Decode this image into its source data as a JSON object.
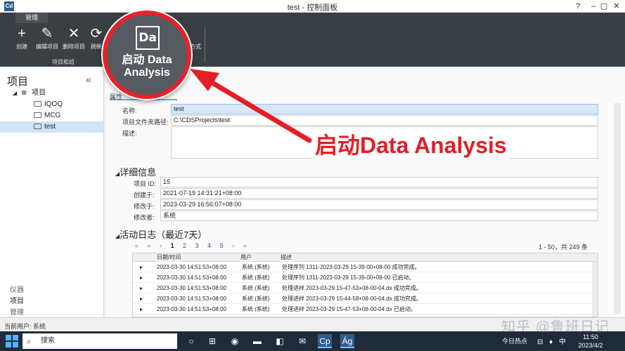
{
  "window": {
    "app_icon": "Cd",
    "title": "test - 控制面板",
    "controls": [
      "?",
      "–",
      "▢",
      "✕"
    ]
  },
  "ribbon": {
    "tab": "管理",
    "buttons": [
      {
        "label": "创建",
        "icon": "plus-icon",
        "glyph": "+"
      },
      {
        "label": "编辑项目",
        "icon": "pencil-icon",
        "glyph": "✎"
      },
      {
        "label": "删除项目",
        "icon": "close-icon",
        "glyph": "✕"
      },
      {
        "label": "刷新",
        "icon": "refresh-icon",
        "glyph": "⟳"
      }
    ],
    "group_label": "项目和组",
    "partial_label": "式方式",
    "launch": {
      "icon_text": "Da",
      "label": "启动 Data Analysis"
    }
  },
  "left_panel": {
    "title": "项目",
    "collapse_glyph": "«",
    "tree": [
      {
        "label": "项目",
        "level": 0
      },
      {
        "label": "IQOQ",
        "level": 1
      },
      {
        "label": "MCG",
        "level": 1
      },
      {
        "label": "test",
        "level": 1,
        "selected": true
      }
    ],
    "footer": [
      {
        "label": "仪器"
      },
      {
        "label": "项目",
        "active": true
      },
      {
        "label": "管理"
      }
    ]
  },
  "properties": {
    "tab_label": "属性",
    "fields": [
      {
        "label": "名称:",
        "value": "test"
      },
      {
        "label": "项目文件夹路径:",
        "value": "C:\\CDSProjects\\test"
      },
      {
        "label": "描述:",
        "value": ""
      }
    ]
  },
  "details": {
    "title": "详细信息",
    "fields": [
      {
        "label": "项目 ID:",
        "value": "15"
      },
      {
        "label": "创建于:",
        "value": "2021-07-19 14:31:21+08:00"
      },
      {
        "label": "修改于:",
        "value": "2023-03-29 16:56:07+08:00"
      },
      {
        "label": "修改者:",
        "value": "系统"
      }
    ]
  },
  "activity": {
    "title": "活动日志（最近7天）",
    "pager": {
      "first": "«",
      "prev_group": "«",
      "prev": "‹",
      "pages": [
        "1",
        "2",
        "3",
        "4",
        "5"
      ],
      "current_page": "1",
      "next": "›",
      "next_group": "»",
      "last": "»",
      "summary": "1 - 50，共 249 条"
    },
    "columns": [
      "日期/时间",
      "用户",
      "描述"
    ],
    "rows": [
      {
        "date": "2023-03-30 14:51:53+08:00",
        "user": "系统 (系统)",
        "desc": "处理序列 1311-2023-03-29 15-39-00+08-00 成功完成。"
      },
      {
        "date": "2023-03-30 14:51:53+08:00",
        "user": "系统 (系统)",
        "desc": "处理序列 1311-2023-03-29 15-39-00+08-00 已启动。"
      },
      {
        "date": "2023-03-30 14:51:53+08:00",
        "user": "系统 (系统)",
        "desc": "处理进样 2023-03-29 15-47-53+08-00-04.dx 成功完成。"
      },
      {
        "date": "2023-03-30 14:51:53+08:00",
        "user": "系统 (系统)",
        "desc": "处理进样 2023-03-29 15-44-58+08-00-04.dx 成功完成。"
      },
      {
        "date": "2023-03-30 14:51:53+08:00",
        "user": "系统 (系统)",
        "desc": "处理进样 2023-03-29 15-47-53+08-00-04.dx 已启动。"
      }
    ]
  },
  "status": {
    "text": "当前用户: 系统"
  },
  "watermark": "知乎 @鲁班日记",
  "annotation": "启动Data Analysis",
  "taskbar": {
    "search_placeholder": "搜索",
    "apps": [
      {
        "name": "task-view-icon",
        "glyph": "○"
      },
      {
        "name": "widgets-icon",
        "glyph": "⊞"
      },
      {
        "name": "edge-icon",
        "glyph": "◉"
      },
      {
        "name": "explorer-icon",
        "glyph": "▬"
      },
      {
        "name": "store-icon",
        "glyph": "◧"
      },
      {
        "name": "mail-icon",
        "glyph": "✉"
      },
      {
        "name": "cds-app-icon",
        "glyph": "Cp",
        "active": true
      },
      {
        "name": "data-analysis-app-icon",
        "glyph": "Ág",
        "active": true
      }
    ],
    "news": "今日热点",
    "tray": "⊟ ♦ 中",
    "time": "11:50",
    "date": "2023/4/2"
  },
  "colors": {
    "ribbon_bg": "#3a3f44",
    "highlight_red": "#e8222a",
    "selection_blue": "#cfe3f5",
    "taskbar_bg": "#1f2b3a"
  }
}
